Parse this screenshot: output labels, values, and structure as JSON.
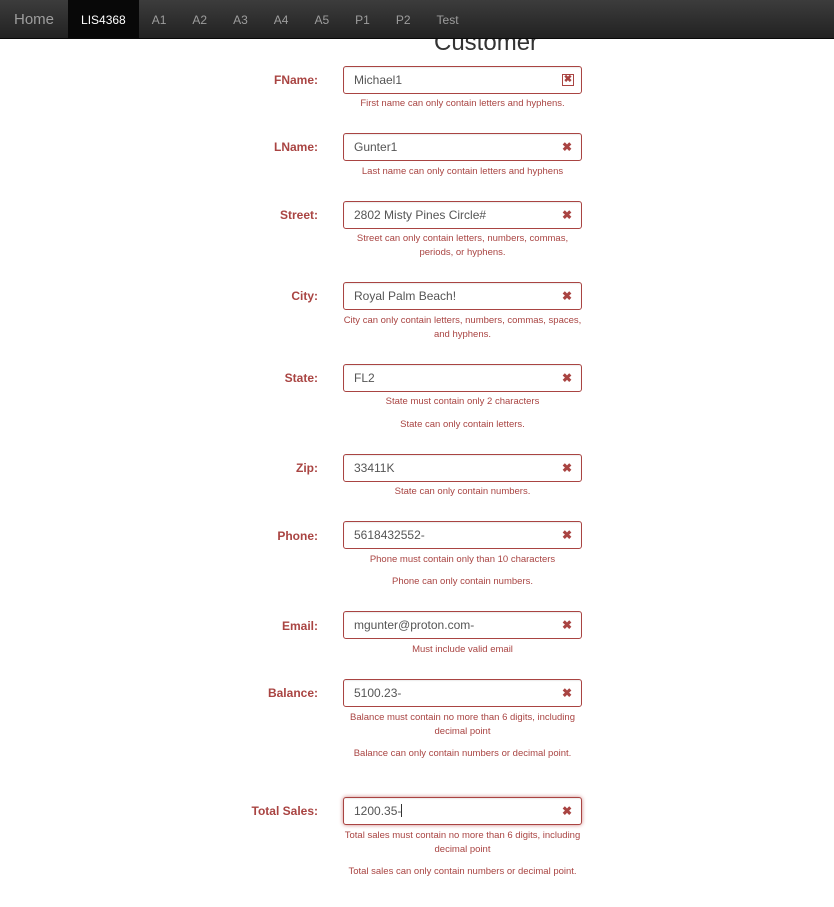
{
  "nav": {
    "brand": "Home",
    "items": [
      {
        "label": "LIS4368",
        "active": true
      },
      {
        "label": "A1"
      },
      {
        "label": "A2"
      },
      {
        "label": "A3"
      },
      {
        "label": "A4"
      },
      {
        "label": "A5"
      },
      {
        "label": "P1"
      },
      {
        "label": "P2"
      },
      {
        "label": "Test"
      }
    ]
  },
  "page": {
    "title": "Customer"
  },
  "form": {
    "fname": {
      "label": "FName:",
      "value": "Michael1",
      "errors": [
        "First name can only contain letters and hyphens."
      ]
    },
    "lname": {
      "label": "LName:",
      "value": "Gunter1",
      "errors": [
        "Last name can only contain letters and hyphens"
      ]
    },
    "street": {
      "label": "Street:",
      "value": "2802 Misty Pines Circle#",
      "errors": [
        "Street can only contain letters, numbers, commas, periods, or hyphens."
      ]
    },
    "city": {
      "label": "City:",
      "value": "Royal Palm Beach!",
      "errors": [
        "City can only contain letters, numbers, commas, spaces, and hyphens."
      ]
    },
    "state": {
      "label": "State:",
      "value": "FL2",
      "errors": [
        "State must contain only 2 characters",
        "State can only contain letters."
      ]
    },
    "zip": {
      "label": "Zip:",
      "value": "33411K",
      "errors": [
        "State can only contain numbers."
      ]
    },
    "phone": {
      "label": "Phone:",
      "value": "5618432552-",
      "errors": [
        "Phone must contain only than 10 characters",
        "Phone can only contain numbers."
      ]
    },
    "email": {
      "label": "Email:",
      "value": "mgunter@proton.com-",
      "errors": [
        "Must include valid email"
      ]
    },
    "balance": {
      "label": "Balance:",
      "value": "5100.23-",
      "errors": [
        "Balance must contain no more than 6 digits, including decimal point",
        "Balance can only contain numbers or decimal point."
      ]
    },
    "total_sales": {
      "label": "Total Sales:",
      "value": "1200.35-",
      "errors": [
        "Total sales must contain no more than 6 digits, including decimal point",
        "Total sales can only contain numbers or decimal point."
      ]
    }
  },
  "icons": {
    "invalid": "close-icon",
    "invalid_glyph": "✖"
  },
  "colors": {
    "error": "#a94442",
    "navbar": "#222222",
    "nav_active": "#080808"
  }
}
